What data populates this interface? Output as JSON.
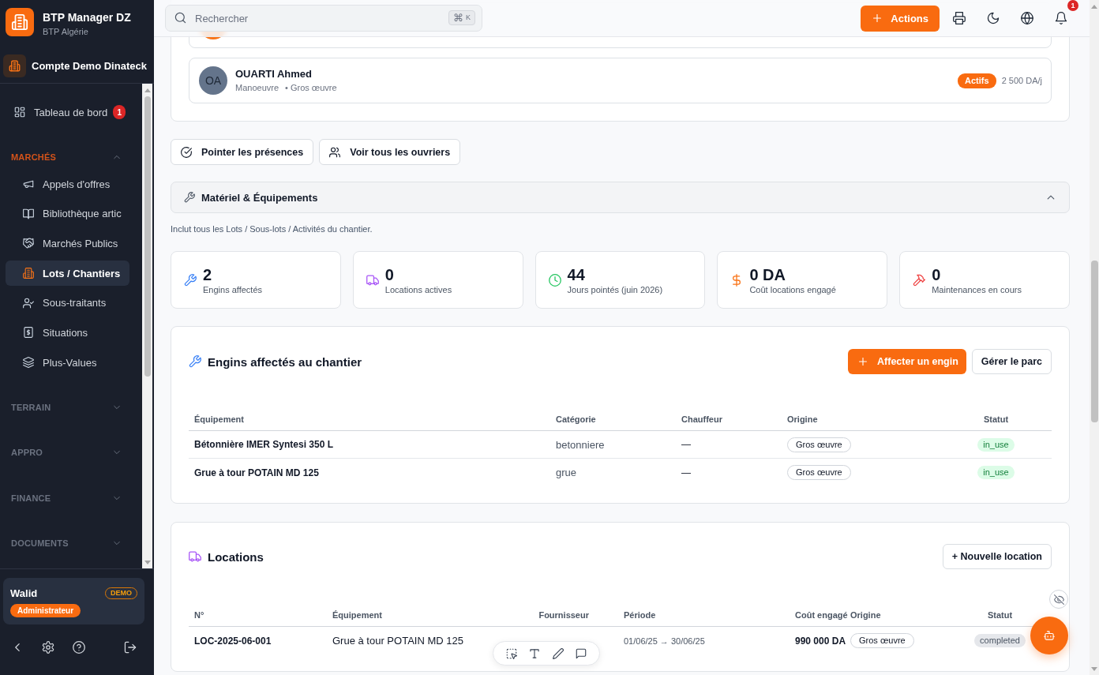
{
  "sidebar": {
    "app_name": "BTP Manager DZ",
    "app_subtitle": "BTP Algérie",
    "account": "Compte Demo Dinateck",
    "dashboard": {
      "label": "Tableau de bord",
      "badge": "1",
      "selected": false
    },
    "sections": [
      {
        "title": "MARCHÉS",
        "expanded": true,
        "items": [
          {
            "label": "Appels d'offres",
            "selected": false
          },
          {
            "label": "Bibliothèque artic",
            "selected": false
          },
          {
            "label": "Marchés Publics",
            "selected": false
          },
          {
            "label": "Lots / Chantiers",
            "selected": true
          },
          {
            "label": "Sous-traitants",
            "selected": false
          },
          {
            "label": "Situations",
            "selected": false
          },
          {
            "label": "Plus-Values",
            "selected": false
          }
        ]
      },
      {
        "title": "TERRAIN",
        "expanded": false
      },
      {
        "title": "APPRO",
        "expanded": false
      },
      {
        "title": "FINANCE",
        "expanded": false
      },
      {
        "title": "DOCUMENTS",
        "expanded": false
      }
    ],
    "user": {
      "name": "Walid",
      "badge": "DEMO",
      "role": "Administrateur"
    }
  },
  "topbar": {
    "search": {
      "placeholder": "Rechercher",
      "shortcut": [
        "⌘",
        "K"
      ]
    },
    "actions_button": "Actions",
    "notification_count": "1"
  },
  "workers": [
    {
      "color": "#f97316"
    },
    {
      "initials": "OA",
      "color": "#64748b",
      "name": "OUARTI Ahmed",
      "details": [
        "Manoeuvre",
        "• Gros œuvre"
      ],
      "status": "Actifs",
      "rate": "2 500 DA/j"
    }
  ],
  "worker_buttons": [
    "Pointer les présences",
    "Voir tous les ouvriers"
  ],
  "equipment": {
    "title": "Matériel & Équipements",
    "expanded": true,
    "note": "Inclut tous les Lots / Sous-lots / Activités du chantier.",
    "stats": [
      {
        "value": "2",
        "label": "Engins affectés"
      },
      {
        "value": "0",
        "label": "Locations actives"
      },
      {
        "value": "44",
        "label": "Jours pointés (juin 2026)"
      },
      {
        "value": "0 DA",
        "label": "Coût locations engagé"
      },
      {
        "value": "0",
        "label": "Maintenances en cours"
      }
    ],
    "assigned": {
      "title": "Engins affectés au chantier",
      "buttons": [
        {
          "label": "Affecter un engin",
          "kind": "primary"
        },
        {
          "label": "Gérer le parc",
          "kind": "secondary"
        }
      ],
      "columns": [
        "Équipement",
        "Catégorie",
        "Chauffeur",
        "Origine",
        "Statut"
      ],
      "rows": [
        {
          "equipment": "Bétonnière IMER Syntesi 350 L",
          "category": "betonniere",
          "driver": "—",
          "origin": "Gros œuvre",
          "status": {
            "label": "in_use",
            "kind": "success"
          }
        },
        {
          "equipment": "Grue à tour POTAIN MD 125",
          "category": "grue",
          "driver": "—",
          "origin": "Gros œuvre",
          "status": {
            "label": "in_use",
            "kind": "success"
          }
        }
      ]
    },
    "rentals": {
      "title": "Locations",
      "button": "+ Nouvelle location",
      "columns": [
        "N°",
        "Équipement",
        "Fournisseur",
        "Période",
        "Coût engagé",
        "Origine",
        "Statut"
      ],
      "rows": [
        {
          "number": "LOC-2025-06-001",
          "equipment": "Grue à tour POTAIN MD 125",
          "period": "01/06/25 → 30/06/25",
          "cost": "990 000 DA",
          "origin": "Gros œuvre",
          "status": {
            "label": "completed",
            "kind": "neutral"
          }
        }
      ]
    }
  }
}
